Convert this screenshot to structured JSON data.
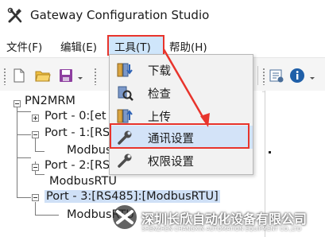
{
  "app": {
    "title": "Gateway Configuration Studio",
    "icon": "tools-icon"
  },
  "menu": {
    "items": [
      {
        "label": "文件(F)"
      },
      {
        "label": "编辑(E)"
      },
      {
        "label": "工具(T)"
      },
      {
        "label": "帮助(H)"
      }
    ]
  },
  "toolbar": {
    "icons": [
      "new-file-icon",
      "open-folder-icon",
      "save-icon",
      "download-dropdown-icon",
      "settings-icon",
      "info-icon"
    ]
  },
  "tree": {
    "root": "PN2MRM",
    "nodes": [
      {
        "label": "Port - 0:[et"
      },
      {
        "label": "Port - 1:[RS"
      },
      {
        "label": "Modbus"
      },
      {
        "label": "Port - 2:[RS"
      },
      {
        "label": "ModbusRTU"
      },
      {
        "label": "Port - 3:[RS485]:[ModbusRTU]"
      },
      {
        "label": "ModbusRTU"
      }
    ]
  },
  "tools_menu": {
    "items": [
      {
        "label": "下载",
        "icon": "download-icon"
      },
      {
        "label": "检查",
        "icon": "check-icon"
      },
      {
        "label": "上传",
        "icon": "upload-icon"
      },
      {
        "label": "通讯设置",
        "icon": "wrench-icon"
      },
      {
        "label": "权限设置",
        "icon": "wrench-icon"
      }
    ]
  },
  "watermark": {
    "cn": "深圳长欣自动化设备有限公司",
    "en": "SHENZHEN CHANGXIN AUTOMATION EQUIPMENT CO.,LTD"
  },
  "colors": {
    "highlight_border": "#e8342c",
    "selection": "#cfe0f6",
    "menu_hover": "#d3e3f8"
  }
}
